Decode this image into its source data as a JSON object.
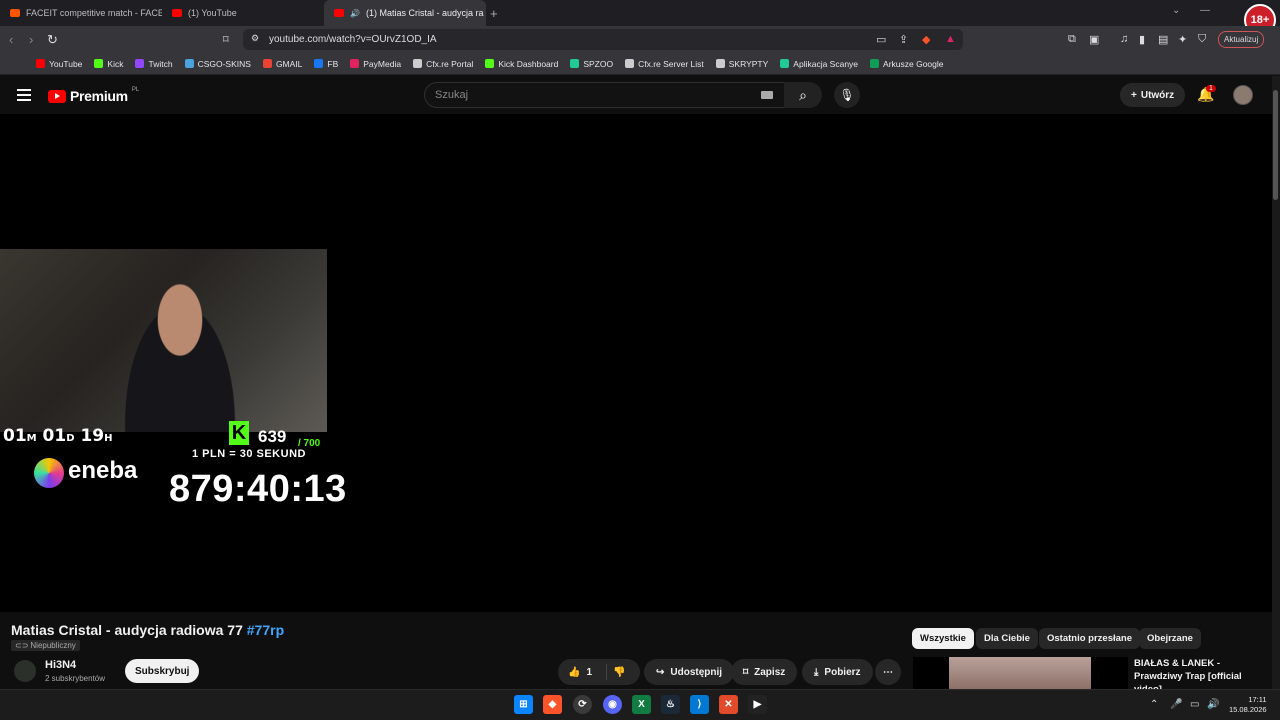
{
  "browser": {
    "tabs": [
      {
        "label": "FACEIT competitive match - FACEIT.c",
        "active": false
      },
      {
        "label": "(1) YouTube",
        "active": false
      },
      {
        "label": "(1) Matias Cristal - audycja ra",
        "active": true
      }
    ],
    "url": "youtube.com/watch?v=OUrvZ1OD_IA",
    "update_label": "Aktualizuj",
    "age_badge": "18+"
  },
  "bookmarks": [
    {
      "label": "YouTube",
      "icon": "youtube-icon",
      "color": "#ff0000"
    },
    {
      "label": "Kick",
      "icon": "kick-icon",
      "color": "#53fc18"
    },
    {
      "label": "Twitch",
      "icon": "twitch-icon",
      "color": "#9146ff"
    },
    {
      "label": "CSGO-SKINS",
      "icon": "globe-icon",
      "color": "#4aa3df"
    },
    {
      "label": "GMAIL",
      "icon": "gmail-icon",
      "color": "#ea4335"
    },
    {
      "label": "FB",
      "icon": "facebook-icon",
      "color": "#1877f2"
    },
    {
      "label": "PayMedia",
      "icon": "paymedia-icon",
      "color": "#e0245e"
    },
    {
      "label": "Cfx.re Portal",
      "icon": "cfx-icon",
      "color": "#cccccc"
    },
    {
      "label": "Kick Dashboard",
      "icon": "kick-icon",
      "color": "#53fc18"
    },
    {
      "label": "SPZOO",
      "icon": "sheet-icon",
      "color": "#20c997"
    },
    {
      "label": "Cfx.re Server List",
      "icon": "cfx-icon",
      "color": "#cccccc"
    },
    {
      "label": "SKRYPTY",
      "icon": "folder-icon",
      "color": "#cccccc"
    },
    {
      "label": "Aplikacja Scanye",
      "icon": "app-icon",
      "color": "#20c997"
    },
    {
      "label": "Arkusze Google",
      "icon": "sheets-icon",
      "color": "#0f9d58"
    }
  ],
  "youtube": {
    "logo_text": "Premium",
    "logo_region": "PL",
    "search_placeholder": "Szukaj",
    "create_label": "Utwórz",
    "notif_count": "1"
  },
  "overlay": {
    "days": "01",
    "days_unit": "M",
    "hours": "01",
    "hours_unit": "D",
    "mins": "19",
    "mins_unit": "H",
    "kick_count": "639",
    "kick_max": "/ 700",
    "rate": "1 PLN = 30 SEKUND",
    "sponsor": "eneba",
    "countdown": "879:40:13"
  },
  "video": {
    "title": "Matias Cristal - audycja radiowa 77",
    "hashtag": "#77rp",
    "visibility": "Niepubliczny",
    "channel": "Hi3N4",
    "subscribers": "2 subskrybentów",
    "subscribe_label": "Subskrybuj",
    "likes": "1",
    "share_label": "Udostępnij",
    "save_label": "Zapisz",
    "download_label": "Pobierz"
  },
  "chips": [
    {
      "label": "Wszystkie",
      "selected": true
    },
    {
      "label": "Dla Ciebie",
      "selected": false
    },
    {
      "label": "Ostatnio przesłane",
      "selected": false
    },
    {
      "label": "Obejrzane",
      "selected": false
    }
  ],
  "recommendation": {
    "title": "BIAŁAS & LANEK - Prawdziwy Trap [official video]"
  },
  "taskbar": {
    "time": "17:11",
    "date": "15.08.2026"
  }
}
